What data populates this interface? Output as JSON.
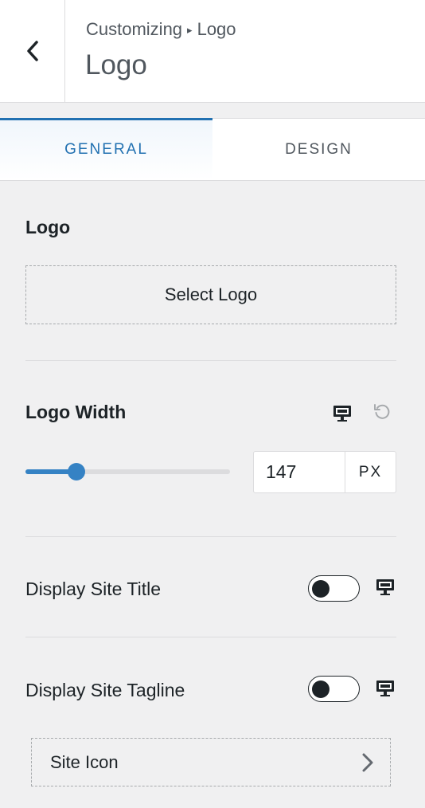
{
  "header": {
    "breadcrumb_parent": "Customizing",
    "breadcrumb_separator": "▸",
    "breadcrumb_current": "Logo",
    "title": "Logo"
  },
  "tabs": [
    {
      "label": "GENERAL",
      "active": true
    },
    {
      "label": "DESIGN",
      "active": false
    }
  ],
  "logo_section": {
    "label": "Logo",
    "select_button": "Select Logo"
  },
  "logo_width": {
    "label": "Logo Width",
    "value": "147",
    "unit": "PX",
    "slider_fraction": 0.25,
    "device_icon": "desktop-icon",
    "reset_icon": "reset-icon"
  },
  "display_site_title": {
    "label": "Display Site Title",
    "enabled": false
  },
  "display_site_tagline": {
    "label": "Display Site Tagline",
    "enabled": false
  },
  "site_icon": {
    "label": "Site Icon"
  },
  "colors": {
    "accent": "#2271b1",
    "slider": "#3582c4",
    "background": "#f0f0f1"
  }
}
